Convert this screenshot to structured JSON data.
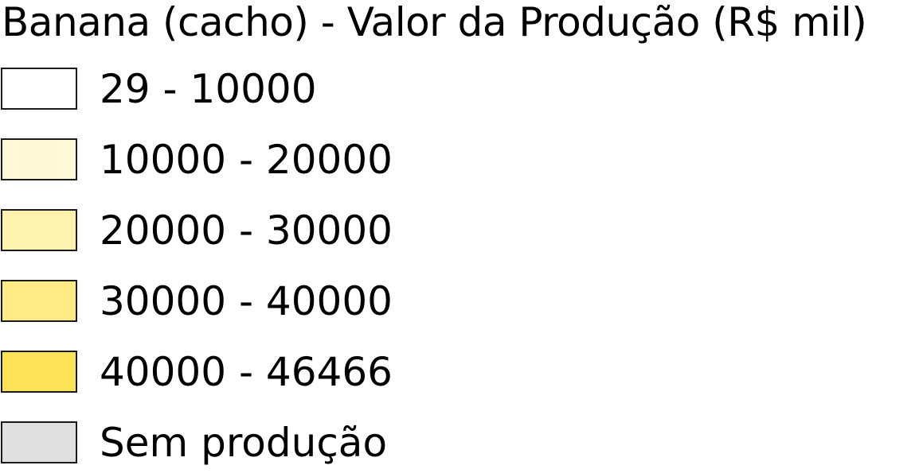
{
  "legend": {
    "title": "Banana (cacho) - Valor da Produção (R$ mil)",
    "items": [
      {
        "label": "29 - 10000",
        "color": "#ffffff"
      },
      {
        "label": "10000 - 20000",
        "color": "#fff8d8"
      },
      {
        "label": "20000 - 30000",
        "color": "#fff1b0"
      },
      {
        "label": "30000 - 40000",
        "color": "#ffea85"
      },
      {
        "label": "40000 - 46466",
        "color": "#ffe45a"
      },
      {
        "label": "Sem produção",
        "color": "#e0e0e0"
      }
    ]
  }
}
